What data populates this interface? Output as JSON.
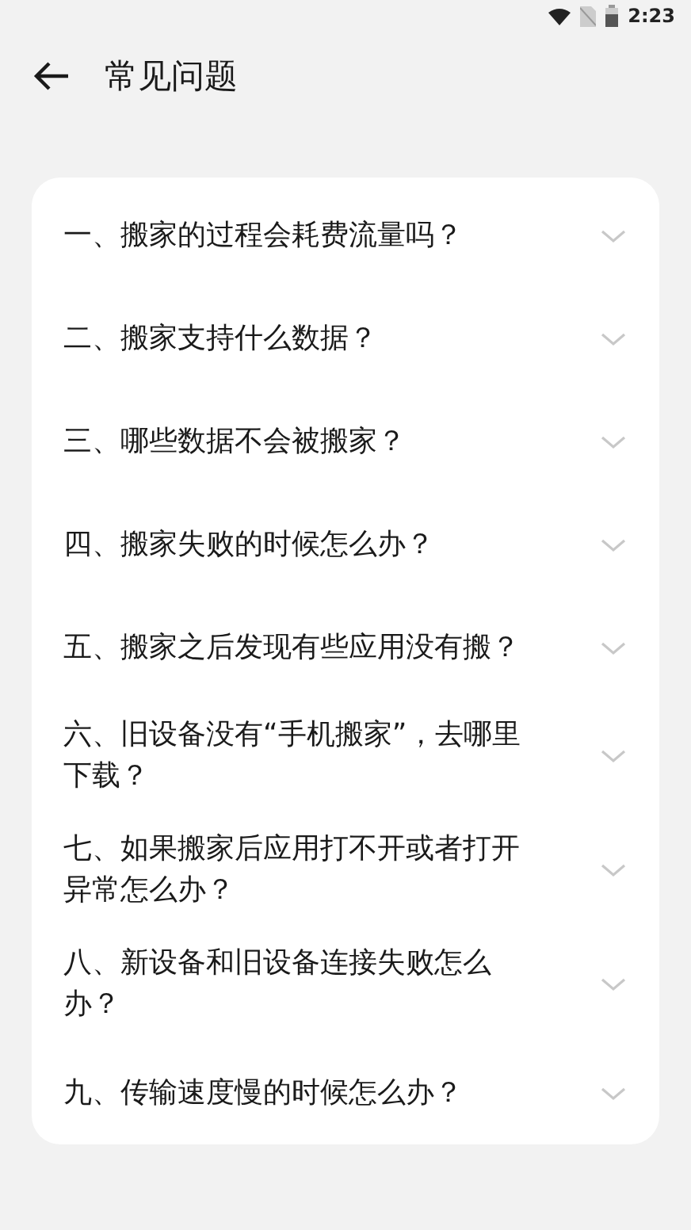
{
  "status_bar": {
    "time": "2:23"
  },
  "header": {
    "title": "常见问题"
  },
  "faq": [
    {
      "question": "一、搬家的过程会耗费流量吗？",
      "expanded": false
    },
    {
      "question": "二、搬家支持什么数据？",
      "expanded": false
    },
    {
      "question": "三、哪些数据不会被搬家？",
      "expanded": false
    },
    {
      "question": "四、搬家失败的时候怎么办？",
      "expanded": false
    },
    {
      "question": "五、搬家之后发现有些应用没有搬？",
      "expanded": false
    },
    {
      "question": "六、旧设备没有“手机搬家”，去哪里下载？",
      "expanded": false
    },
    {
      "question": "七、如果搬家后应用打不开或者打开异常怎么办？",
      "expanded": false
    },
    {
      "question": "八、新设备和旧设备连接失败怎么办？",
      "expanded": false
    },
    {
      "question": "九、传输速度慢的时候怎么办？",
      "expanded": false
    }
  ]
}
